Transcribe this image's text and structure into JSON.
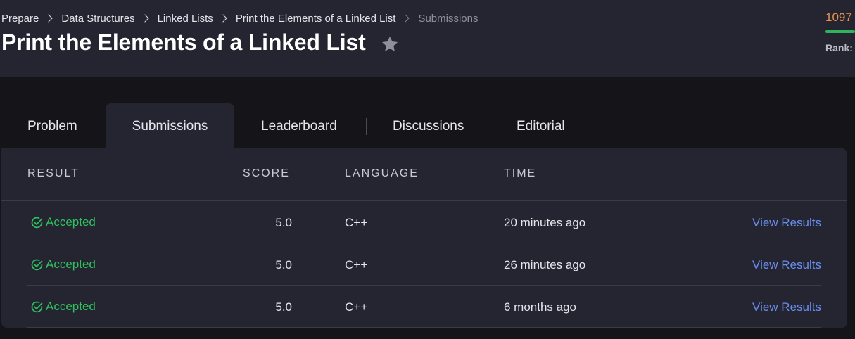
{
  "breadcrumb": [
    "Prepare",
    "Data Structures",
    "Linked Lists",
    "Print the Elements of a Linked List",
    "Submissions"
  ],
  "page_title": "Print the Elements of a Linked List",
  "score_summary": {
    "points": "1097",
    "rank_label": "Rank:"
  },
  "tabs": [
    {
      "label": "Problem"
    },
    {
      "label": "Submissions"
    },
    {
      "label": "Leaderboard"
    },
    {
      "label": "Discussions"
    },
    {
      "label": "Editorial"
    }
  ],
  "active_tab": "Submissions",
  "table": {
    "headers": {
      "result": "RESULT",
      "score": "SCORE",
      "language": "LANGUAGE",
      "time": "TIME"
    },
    "rows": [
      {
        "result": "Accepted",
        "score": "5.0",
        "language": "C++",
        "time": "20 minutes ago",
        "action": "View Results"
      },
      {
        "result": "Accepted",
        "score": "5.0",
        "language": "C++",
        "time": "26 minutes ago",
        "action": "View Results"
      },
      {
        "result": "Accepted",
        "score": "5.0",
        "language": "C++",
        "time": "6 months ago",
        "action": "View Results"
      }
    ]
  },
  "colors": {
    "header_bg": "#242530",
    "page_bg": "#151519",
    "accepted_green": "#2fc15f",
    "link_blue": "#6a8df0",
    "points_orange": "#e8914a",
    "progress_green": "#2fb35b",
    "star_gray": "#8d8f9c"
  },
  "icons": {
    "favorite": "star-icon",
    "accepted": "check-circle-icon",
    "breadcrumb_separator": "chevron-right-icon"
  }
}
